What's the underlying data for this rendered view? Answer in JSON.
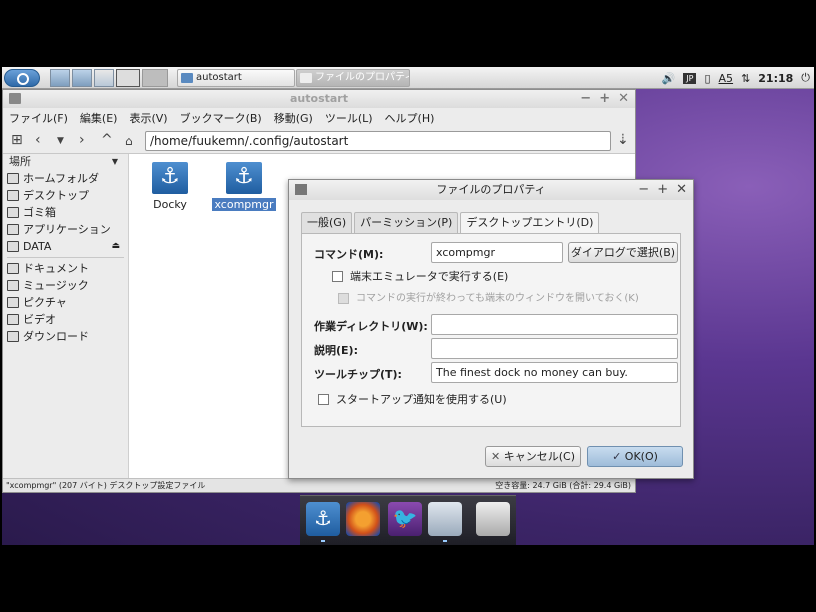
{
  "panel": {
    "tasks": [
      {
        "label": "autostart"
      },
      {
        "label": "ファイルのプロパティ"
      }
    ],
    "tray": {
      "input_method": "JP",
      "keyboard": "A5",
      "clock": "21:18"
    }
  },
  "file_manager": {
    "title": "autostart",
    "menu": [
      "ファイル(F)",
      "編集(E)",
      "表示(V)",
      "ブックマーク(B)",
      "移動(G)",
      "ツール(L)",
      "ヘルプ(H)"
    ],
    "path": "/home/fuukemn/.config/autostart",
    "sidebar": {
      "header": "場所",
      "places": [
        {
          "label": "ホームフォルダ",
          "icon": "home-icon"
        },
        {
          "label": "デスクトップ",
          "icon": "desktop-icon"
        },
        {
          "label": "ゴミ箱",
          "icon": "trash-icon"
        },
        {
          "label": "アプリケーション",
          "icon": "applications-icon"
        },
        {
          "label": "DATA",
          "icon": "drive-icon"
        }
      ],
      "bookmarks": [
        {
          "label": "ドキュメント",
          "icon": "documents-icon"
        },
        {
          "label": "ミュージック",
          "icon": "music-icon"
        },
        {
          "label": "ピクチャ",
          "icon": "pictures-icon"
        },
        {
          "label": "ビデオ",
          "icon": "video-icon"
        },
        {
          "label": "ダウンロード",
          "icon": "download-icon"
        }
      ]
    },
    "files": [
      {
        "label": "Docky"
      },
      {
        "label": "xcompmgr"
      }
    ],
    "status_left": "\"xcompmgr\" (207 バイト) デスクトップ設定ファイル",
    "status_right": "空き容量: 24.7 GiB (合計: 29.4 GiB)"
  },
  "dialog": {
    "title": "ファイルのプロパティ",
    "tabs": [
      "一般(G)",
      "パーミッション(P)",
      "デスクトップエントリ(D)"
    ],
    "command_label": "コマンド(M):",
    "command_value": "xcompmgr",
    "choose_button": "ダイアログで選択(B)",
    "terminal_check": "端末エミュレータで実行する(E)",
    "keep_window_check": "コマンドの実行が終わっても端末のウィンドウを開いておく(K)",
    "workdir_label": "作業ディレクトリ(W):",
    "workdir_value": "",
    "description_label": "説明(E):",
    "description_value": "",
    "tooltip_label": "ツールチップ(T):",
    "tooltip_value": "The finest dock no money can buy.",
    "startup_check": "スタートアップ通知を使用する(U)",
    "cancel_button": "キャンセル(C)",
    "ok_button": "OK(O)"
  }
}
